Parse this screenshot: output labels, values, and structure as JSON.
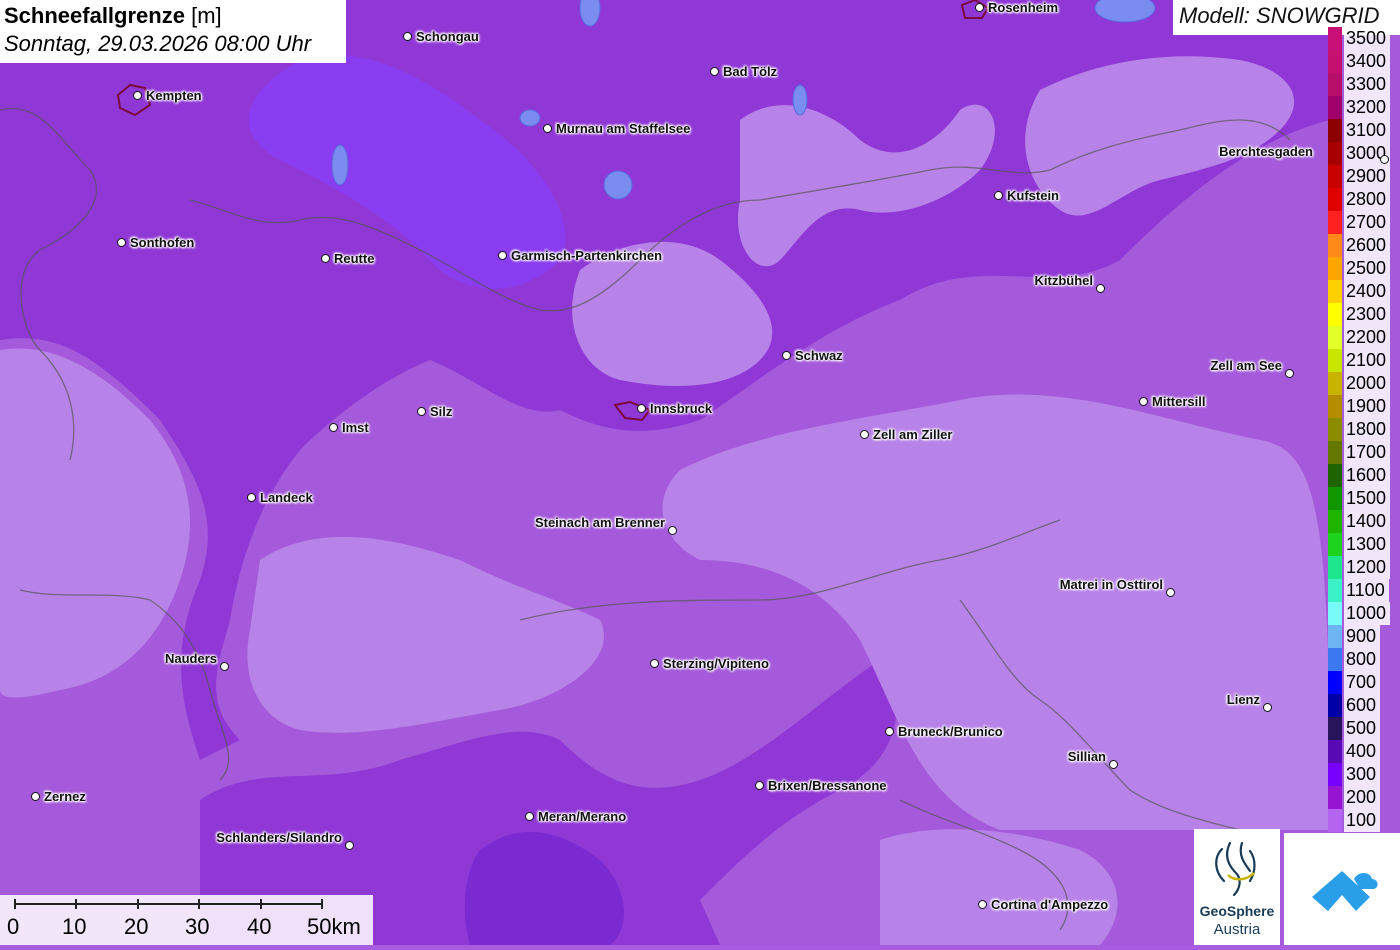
{
  "title": {
    "main": "Schneefallgrenze",
    "unit": "[m]",
    "datetime": "Sonntag, 29.03.2026 08:00 Uhr"
  },
  "model_label": "Modell: SNOWGRID",
  "legend": [
    {
      "label": "3500",
      "color": "#c80f78"
    },
    {
      "label": "3400",
      "color": "#c5106f"
    },
    {
      "label": "3300",
      "color": "#b80f6b"
    },
    {
      "label": "3200",
      "color": "#a0006a"
    },
    {
      "label": "3100",
      "color": "#8c0000"
    },
    {
      "label": "3000",
      "color": "#a80000"
    },
    {
      "label": "2900",
      "color": "#c80000"
    },
    {
      "label": "2800",
      "color": "#e00000"
    },
    {
      "label": "2700",
      "color": "#ff2020"
    },
    {
      "label": "2600",
      "color": "#ff8a1a"
    },
    {
      "label": "2500",
      "color": "#ffa500"
    },
    {
      "label": "2400",
      "color": "#ffd000"
    },
    {
      "label": "2300",
      "color": "#ffff00"
    },
    {
      "label": "2200",
      "color": "#e3ff2a"
    },
    {
      "label": "2100",
      "color": "#c8e600"
    },
    {
      "label": "2000",
      "color": "#c8b400"
    },
    {
      "label": "1900",
      "color": "#b48c00"
    },
    {
      "label": "1800",
      "color": "#8c8c00"
    },
    {
      "label": "1700",
      "color": "#647800"
    },
    {
      "label": "1600",
      "color": "#1e6400"
    },
    {
      "label": "1500",
      "color": "#129600"
    },
    {
      "label": "1400",
      "color": "#1eb400"
    },
    {
      "label": "1300",
      "color": "#1ed21e"
    },
    {
      "label": "1200",
      "color": "#1ee68c"
    },
    {
      "label": "1100",
      "color": "#3cf0c8"
    },
    {
      "label": "1000",
      "color": "#78fafa"
    },
    {
      "label": "900",
      "color": "#6eb4f0"
    },
    {
      "label": "800",
      "color": "#3c78f0"
    },
    {
      "label": "700",
      "color": "#0000ff"
    },
    {
      "label": "600",
      "color": "#0000a8"
    },
    {
      "label": "500",
      "color": "#28145a"
    },
    {
      "label": "400",
      "color": "#5a0ab4"
    },
    {
      "label": "300",
      "color": "#7800ff"
    },
    {
      "label": "200",
      "color": "#9614d2"
    },
    {
      "label": "100",
      "color": "#b464f0"
    }
  ],
  "cities": [
    {
      "name": "Rosenheim",
      "side": "right"
    },
    {
      "name": "Schongau",
      "side": "right"
    },
    {
      "name": "Bad Tölz",
      "side": "right"
    },
    {
      "name": "Kempten",
      "side": "right"
    },
    {
      "name": "Murnau am Staffelsee",
      "side": "right"
    },
    {
      "name": "Berchtesgaden",
      "side": "left"
    },
    {
      "name": "Kufstein",
      "side": "right"
    },
    {
      "name": "Sonthofen",
      "side": "right"
    },
    {
      "name": "Reutte",
      "side": "right"
    },
    {
      "name": "Garmisch-Partenkirchen",
      "side": "right"
    },
    {
      "name": "Kitzbühel",
      "side": "left"
    },
    {
      "name": "Schwaz",
      "side": "right"
    },
    {
      "name": "Zell am See",
      "side": "left"
    },
    {
      "name": "Innsbruck",
      "side": "right"
    },
    {
      "name": "Silz",
      "side": "right"
    },
    {
      "name": "Imst",
      "side": "right"
    },
    {
      "name": "Mittersill",
      "side": "right"
    },
    {
      "name": "Zell am Ziller",
      "side": "right"
    },
    {
      "name": "Landeck",
      "side": "right"
    },
    {
      "name": "Steinach am Brenner",
      "side": "left"
    },
    {
      "name": "Matrei in Osttirol",
      "side": "left"
    },
    {
      "name": "Nauders",
      "side": "left"
    },
    {
      "name": "Sterzing/Vipiteno",
      "side": "right"
    },
    {
      "name": "Lienz",
      "side": "left"
    },
    {
      "name": "Bruneck/Brunico",
      "side": "right"
    },
    {
      "name": "Sillian",
      "side": "left"
    },
    {
      "name": "Brixen/Bressanone",
      "side": "right"
    },
    {
      "name": "Zernez",
      "side": "right"
    },
    {
      "name": "Meran/Merano",
      "side": "right"
    },
    {
      "name": "Schlanders/Silandro",
      "side": "left"
    },
    {
      "name": "Cortina d'Ampezzo",
      "side": "right"
    }
  ],
  "scale": {
    "labels": [
      "0",
      "10",
      "20",
      "30",
      "40",
      "50km"
    ]
  },
  "logos": {
    "geosphere_line1": "GeoSphere",
    "geosphere_line2": "Austria"
  }
}
